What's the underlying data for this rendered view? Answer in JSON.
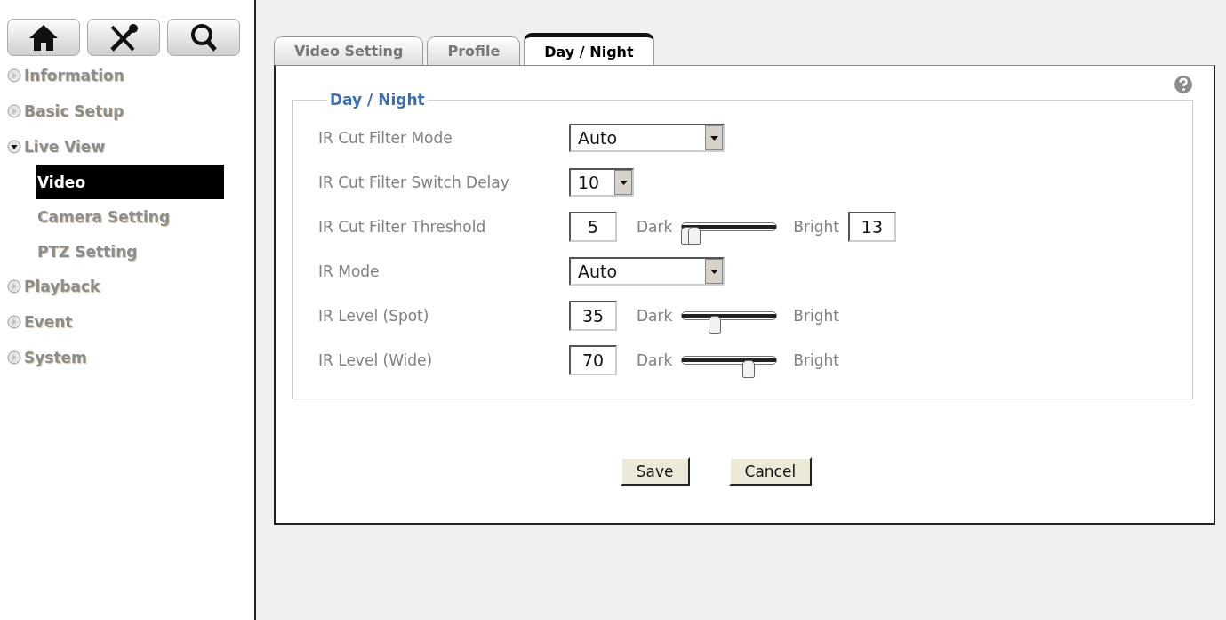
{
  "toolbar": [
    {
      "kind": "home"
    },
    {
      "kind": "tools"
    },
    {
      "kind": "search"
    }
  ],
  "sidebar": {
    "items": [
      {
        "label": "Information",
        "expanded": false
      },
      {
        "label": "Basic Setup",
        "expanded": false
      },
      {
        "label": "Live View",
        "expanded": true,
        "children": [
          {
            "label": "Video",
            "selected": true
          },
          {
            "label": "Camera Setting",
            "selected": false
          },
          {
            "label": "PTZ Setting",
            "selected": false
          }
        ]
      },
      {
        "label": "Playback",
        "expanded": false
      },
      {
        "label": "Event",
        "expanded": false
      },
      {
        "label": "System",
        "expanded": false
      }
    ]
  },
  "tabs": [
    {
      "label": "Video Setting",
      "selected": false
    },
    {
      "label": "Profile",
      "selected": false
    },
    {
      "label": "Day / Night",
      "selected": true
    }
  ],
  "section": {
    "title": "Day / Night",
    "rows": [
      {
        "kind": "select",
        "label": "IR Cut Filter Mode",
        "value": "Auto",
        "wide": true
      },
      {
        "kind": "select",
        "label": "IR Cut Filter Switch Delay",
        "value": "10",
        "wide": false
      },
      {
        "kind": "range",
        "label": "IR Cut Filter Threshold",
        "value": "5",
        "low_label": "Dark",
        "high_label": "Bright",
        "thumbs": [
          {
            "level": 0.05
          },
          {
            "level": 0.13
          }
        ],
        "max_value": "13"
      },
      {
        "kind": "select",
        "label": "IR Mode",
        "value": "Auto",
        "wide": true
      },
      {
        "kind": "slider",
        "label": "IR Level (Spot)",
        "value": "35",
        "low_label": "Dark",
        "high_label": "Bright",
        "level": 0.35
      },
      {
        "kind": "slider",
        "label": "IR Level (Wide)",
        "value": "70",
        "low_label": "Dark",
        "high_label": "Bright",
        "level": 0.7
      }
    ]
  },
  "buttons": [
    "Save",
    "Cancel"
  ]
}
